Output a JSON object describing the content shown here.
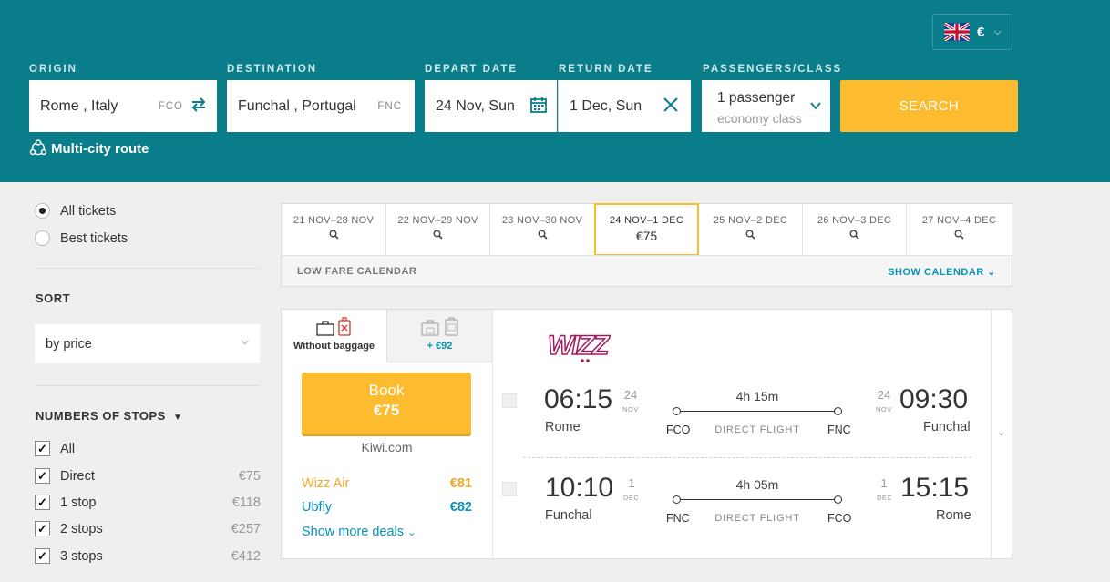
{
  "header": {
    "currency": "€",
    "fields": {
      "origin": {
        "label": "ORIGIN",
        "value": "Rome , Italy",
        "code": "FCO"
      },
      "destination": {
        "label": "DESTINATION",
        "value": "Funchal , Portugal",
        "code": "FNC"
      },
      "depart": {
        "label": "DEPART DATE",
        "value": "24 Nov, Sun"
      },
      "return": {
        "label": "RETURN DATE",
        "value": "1 Dec, Sun"
      },
      "passengers": {
        "label": "PASSENGERS/CLASS",
        "line1": "1 passenger",
        "line2": "economy class"
      }
    },
    "search_label": "SEARCH",
    "multi_city": "Multi-city route"
  },
  "sidebar": {
    "ticket_filter": [
      {
        "label": "All tickets",
        "selected": true
      },
      {
        "label": "Best tickets",
        "selected": false
      }
    ],
    "sort_heading": "SORT",
    "sort_value": "by price",
    "stops_heading": "NUMBERS OF STOPS",
    "stops": [
      {
        "label": "All",
        "price": "",
        "checked": true
      },
      {
        "label": "Direct",
        "price": "€75",
        "checked": true
      },
      {
        "label": "1 stop",
        "price": "€118",
        "checked": true
      },
      {
        "label": "2 stops",
        "price": "€257",
        "checked": true
      },
      {
        "label": "3 stops",
        "price": "€412",
        "checked": true
      }
    ]
  },
  "dates": {
    "cells": [
      {
        "range": "21 NOV–28 NOV",
        "price": "",
        "selected": false
      },
      {
        "range": "22 NOV–29 NOV",
        "price": "",
        "selected": false
      },
      {
        "range": "23 NOV–30 NOV",
        "price": "",
        "selected": false
      },
      {
        "range": "24 NOV–1 DEC",
        "price": "€75",
        "selected": true
      },
      {
        "range": "25 NOV–2 DEC",
        "price": "",
        "selected": false
      },
      {
        "range": "26 NOV–3 DEC",
        "price": "",
        "selected": false
      },
      {
        "range": "27 NOV–4 DEC",
        "price": "",
        "selected": false
      }
    ],
    "low_fare": "LOW FARE CALENDAR",
    "show_calendar": "SHOW CALENDAR"
  },
  "result": {
    "tabs": {
      "without_baggage": "Without baggage",
      "with_baggage_price": "+ €92"
    },
    "book": {
      "label": "Book",
      "price": "€75"
    },
    "provider": "Kiwi.com",
    "deals": [
      {
        "name": "Wizz Air",
        "price": "€81",
        "color": "#f5a623"
      },
      {
        "name": "Ubfly",
        "price": "€82",
        "color": "#0a93b8"
      }
    ],
    "show_more": "Show more deals",
    "airline_logo": "wizz",
    "segments": [
      {
        "dep_time": "06:15",
        "dep_day": "24",
        "dep_mon": "NOV",
        "dep_city": "Rome",
        "dep_code": "FCO",
        "duration": "4h 15m",
        "type": "DIRECT FLIGHT",
        "arr_time": "09:30",
        "arr_day": "24",
        "arr_mon": "NOV",
        "arr_city": "Funchal",
        "arr_code": "FNC"
      },
      {
        "dep_time": "10:10",
        "dep_day": "1",
        "dep_mon": "DEC",
        "dep_city": "Funchal",
        "dep_code": "FNC",
        "duration": "4h 05m",
        "type": "DIRECT FLIGHT",
        "arr_time": "15:15",
        "arr_day": "1",
        "arr_mon": "DEC",
        "arr_city": "Rome",
        "arr_code": "FCO"
      }
    ]
  },
  "colors": {
    "header_bg": "#0a7d8a",
    "accent_yellow": "#fdbb2f",
    "link_blue": "#0a93b8"
  }
}
